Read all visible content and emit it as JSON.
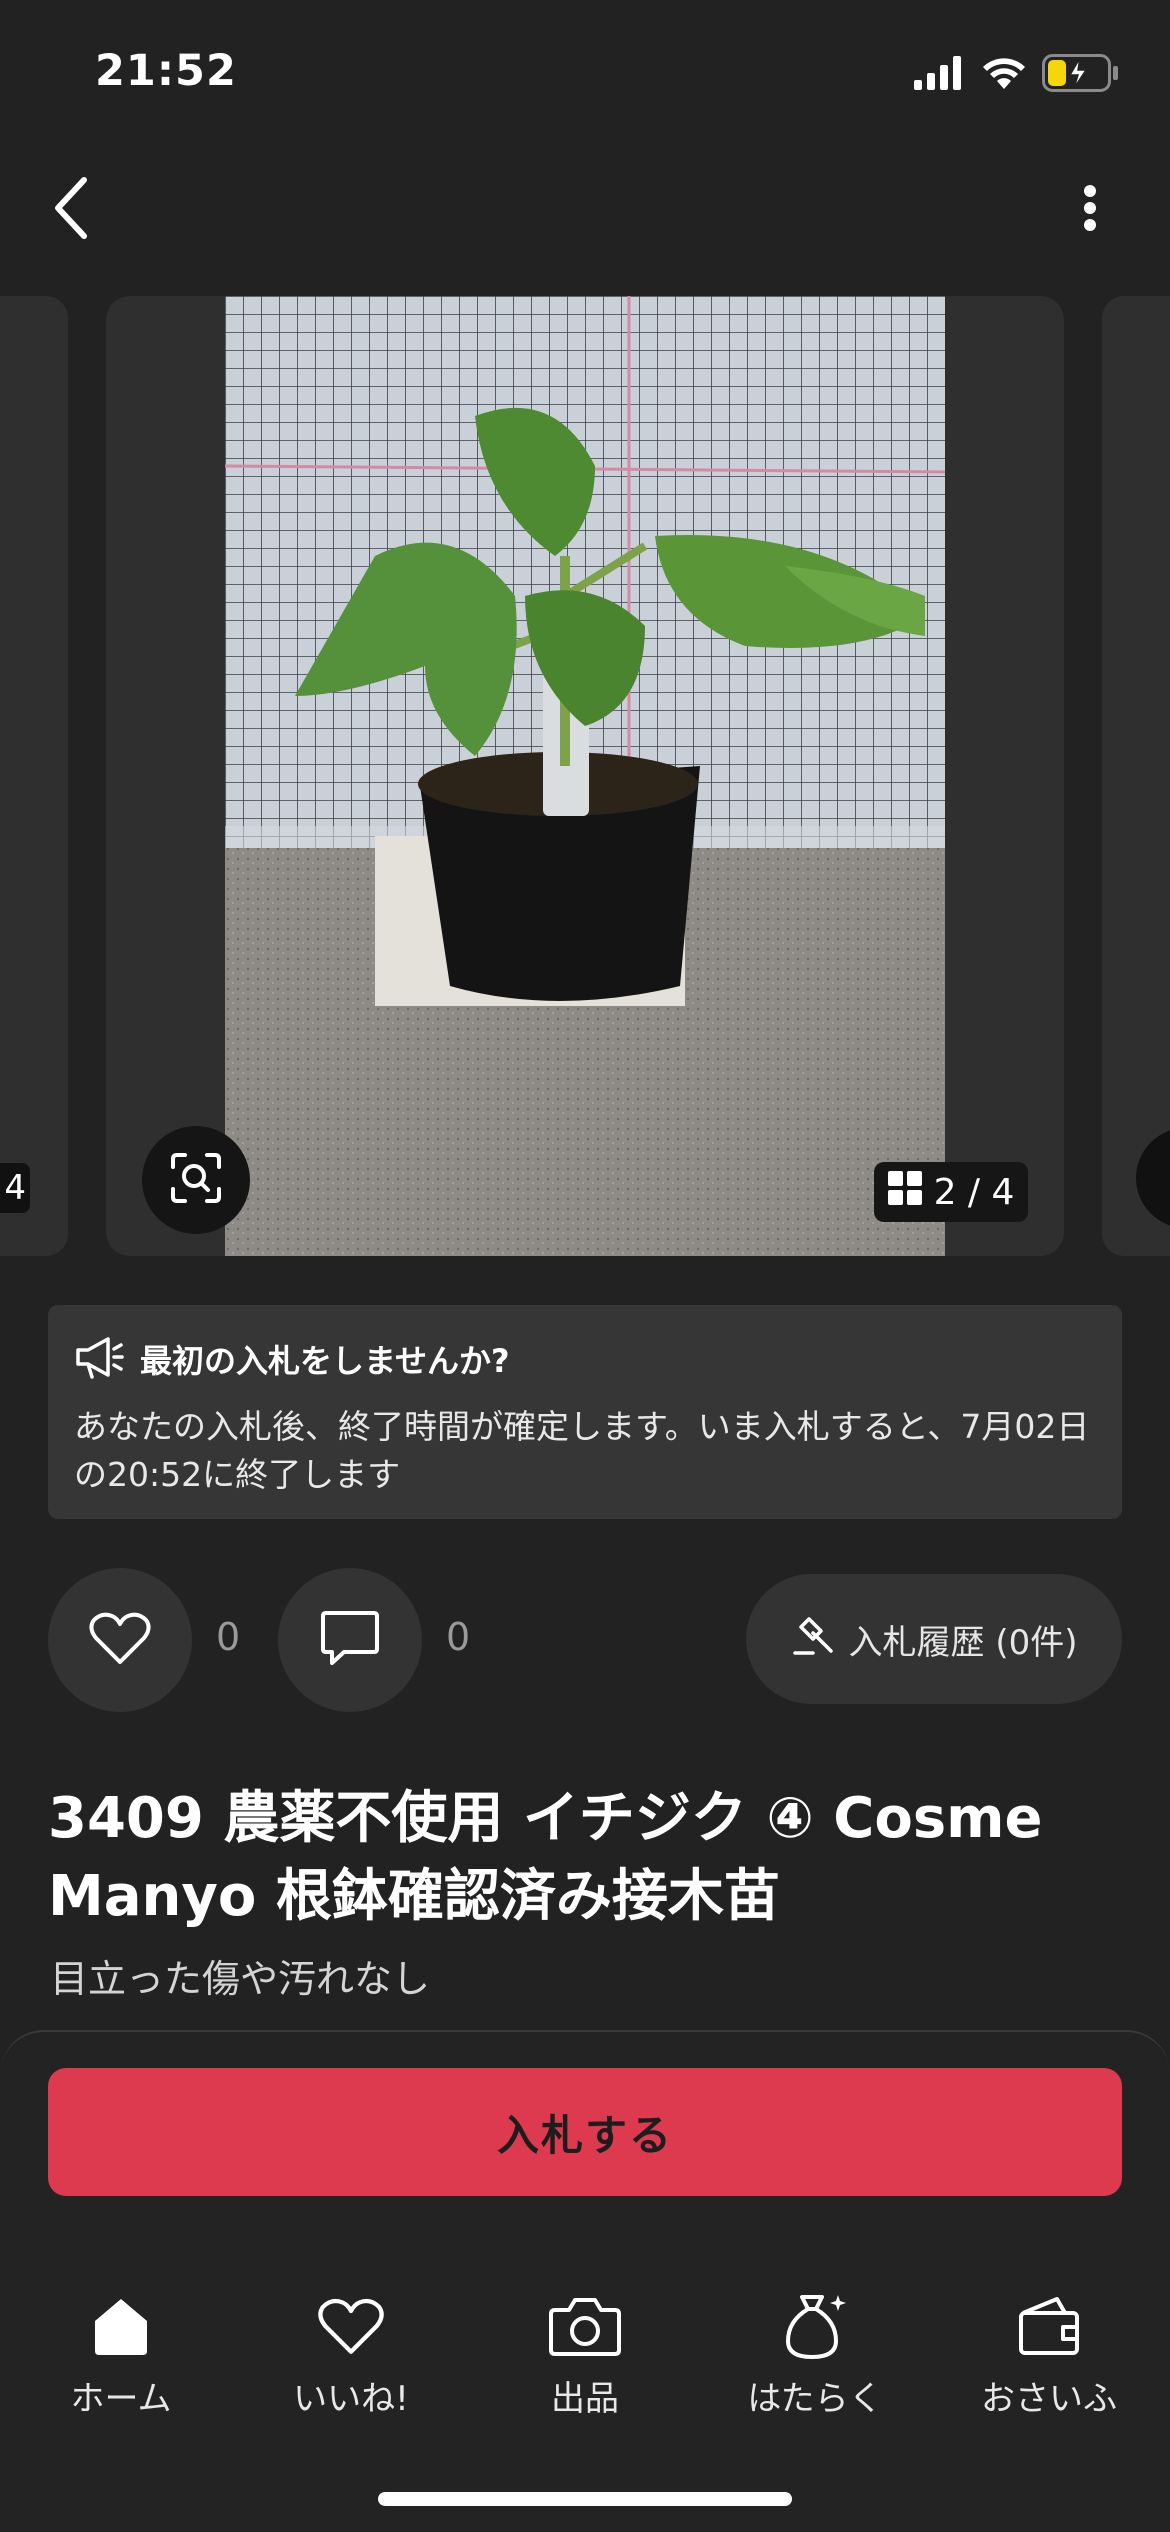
{
  "status_bar": {
    "time": "21:52"
  },
  "header": {
    "back_icon": "chevron-left-icon",
    "more_icon": "more-vertical-icon"
  },
  "gallery": {
    "counter": "2 / 4",
    "prev_counter": "4",
    "image_description_icon": "zoom-search-icon"
  },
  "notice": {
    "title": "最初の入札をしませんか?",
    "body": "あなたの入札後、終了時間が確定します。いま入札すると、7月02日の20:52に終了します"
  },
  "actions": {
    "like_count": "0",
    "comment_count": "0",
    "bid_history_label": "入札履歴 (0件)"
  },
  "item": {
    "title": "3409 農薬不使用 イチジク ④ Cosme Manyo 根鉢確認済み接木苗",
    "condition": "目立った傷や汚れなし"
  },
  "bid_button": {
    "label": "入札する",
    "color": "#de3a4f"
  },
  "tabbar": {
    "items": [
      {
        "label": "ホーム",
        "icon": "home-icon"
      },
      {
        "label": "いいね!",
        "icon": "heart-icon"
      },
      {
        "label": "出品",
        "icon": "camera-icon"
      },
      {
        "label": "はたらく",
        "icon": "money-bag-icon"
      },
      {
        "label": "おさいふ",
        "icon": "wallet-icon"
      }
    ]
  }
}
